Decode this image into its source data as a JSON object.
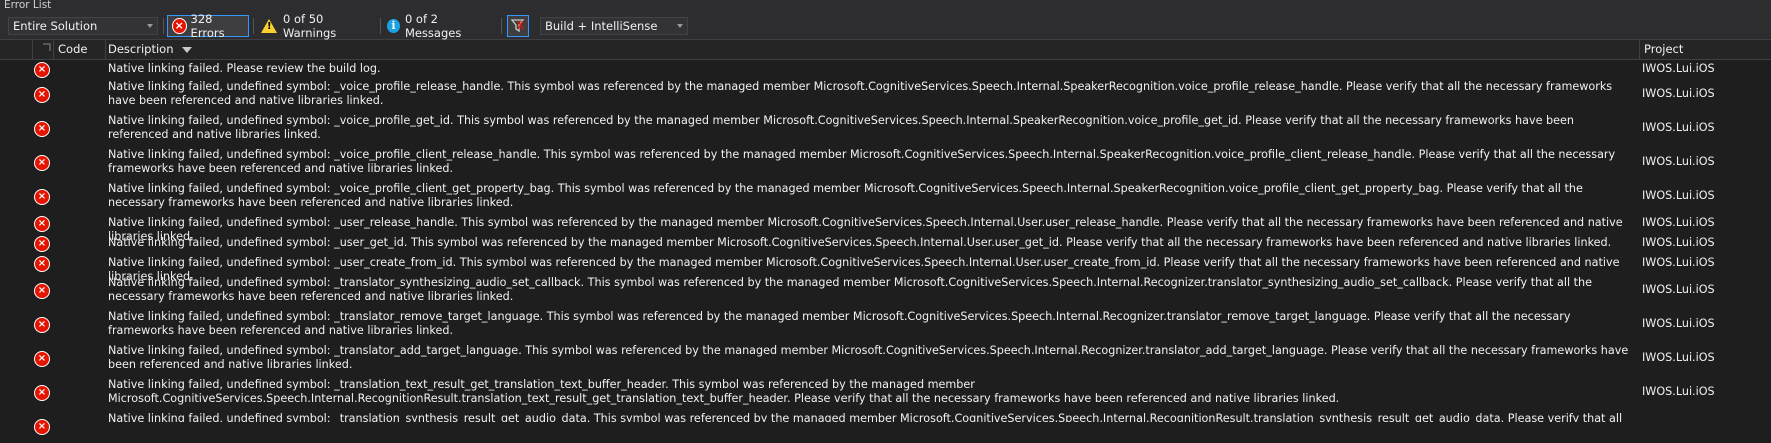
{
  "panel_title": "Error List",
  "toolbar": {
    "scope_value": "Entire Solution",
    "errors_label": "328 Errors",
    "warnings_label": "0 of 50 Warnings",
    "messages_label": "0 of 2 Messages",
    "build_filter_value": "Build + IntelliSense"
  },
  "columns": {
    "code": "Code",
    "description": "Description",
    "project": "Project"
  },
  "rows": [
    {
      "desc": "Native linking failed. Please review the build log.",
      "project": "IWOS.Lui.iOS"
    },
    {
      "desc": "Native linking failed, undefined symbol: _voice_profile_release_handle. This symbol was referenced by the managed member Microsoft.CognitiveServices.Speech.Internal.SpeakerRecognition.voice_profile_release_handle. Please verify that all the necessary frameworks have been referenced and native libraries linked.",
      "project": "IWOS.Lui.iOS"
    },
    {
      "desc": "Native linking failed, undefined symbol: _voice_profile_get_id. This symbol was referenced by the managed member Microsoft.CognitiveServices.Speech.Internal.SpeakerRecognition.voice_profile_get_id. Please verify that all the necessary frameworks have been referenced and native libraries linked.",
      "project": "IWOS.Lui.iOS"
    },
    {
      "desc": "Native linking failed, undefined symbol: _voice_profile_client_release_handle. This symbol was referenced by the managed member Microsoft.CognitiveServices.Speech.Internal.SpeakerRecognition.voice_profile_client_release_handle. Please verify that all the necessary frameworks have been referenced and native libraries linked.",
      "project": "IWOS.Lui.iOS"
    },
    {
      "desc": "Native linking failed, undefined symbol: _voice_profile_client_get_property_bag. This symbol was referenced by the managed member Microsoft.CognitiveServices.Speech.Internal.SpeakerRecognition.voice_profile_client_get_property_bag. Please verify that all the necessary frameworks have been referenced and native libraries linked.",
      "project": "IWOS.Lui.iOS"
    },
    {
      "desc": "Native linking failed, undefined symbol: _user_release_handle. This symbol was referenced by the managed member Microsoft.CognitiveServices.Speech.Internal.User.user_release_handle. Please verify that all the necessary frameworks have been referenced and native libraries linked.",
      "project": "IWOS.Lui.iOS"
    },
    {
      "desc": "Native linking failed, undefined symbol: _user_get_id. This symbol was referenced by the managed member Microsoft.CognitiveServices.Speech.Internal.User.user_get_id. Please verify that all the necessary frameworks have been referenced and native libraries linked.",
      "project": "IWOS.Lui.iOS"
    },
    {
      "desc": "Native linking failed, undefined symbol: _user_create_from_id. This symbol was referenced by the managed member Microsoft.CognitiveServices.Speech.Internal.User.user_create_from_id. Please verify that all the necessary frameworks have been referenced and native libraries linked.",
      "project": "IWOS.Lui.iOS"
    },
    {
      "desc": "Native linking failed, undefined symbol: _translator_synthesizing_audio_set_callback. This symbol was referenced by the managed member Microsoft.CognitiveServices.Speech.Internal.Recognizer.translator_synthesizing_audio_set_callback. Please verify that all the necessary frameworks have been referenced and native libraries linked.",
      "project": "IWOS.Lui.iOS"
    },
    {
      "desc": "Native linking failed, undefined symbol: _translator_remove_target_language. This symbol was referenced by the managed member Microsoft.CognitiveServices.Speech.Internal.Recognizer.translator_remove_target_language. Please verify that all the necessary frameworks have been referenced and native libraries linked.",
      "project": "IWOS.Lui.iOS"
    },
    {
      "desc": "Native linking failed, undefined symbol: _translator_add_target_language. This symbol was referenced by the managed member Microsoft.CognitiveServices.Speech.Internal.Recognizer.translator_add_target_language. Please verify that all the necessary frameworks have been referenced and native libraries linked.",
      "project": "IWOS.Lui.iOS"
    },
    {
      "desc": "Native linking failed, undefined symbol: _translation_text_result_get_translation_text_buffer_header. This symbol was referenced by the managed member Microsoft.CognitiveServices.Speech.Internal.RecognitionResult.translation_text_result_get_translation_text_buffer_header. Please verify that all the necessary frameworks have been referenced and native libraries linked.",
      "project": "IWOS.Lui.iOS"
    },
    {
      "desc": "Native linking failed, undefined symbol: _translation_synthesis_result_get_audio_data. This symbol was referenced by the managed member Microsoft.CognitiveServices.Speech.Internal.RecognitionResult.translation_synthesis_result_get_audio_data. Please verify that all the necessary",
      "project": ""
    }
  ],
  "colors": {
    "background": "#1e1e1e",
    "error_icon": "#e51400",
    "warning_icon": "#f8d12f",
    "info_icon": "#1ba1e2",
    "active_border": "#3399ff"
  }
}
